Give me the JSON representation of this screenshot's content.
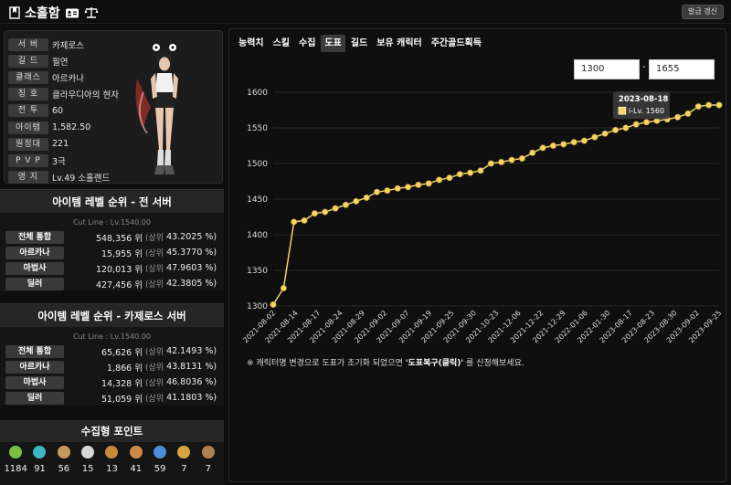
{
  "header": {
    "title": "소홀함",
    "refresh_label": "발급 갱신"
  },
  "profile": {
    "rows": [
      {
        "key": "서 버",
        "value": "카제로스"
      },
      {
        "key": "길 드",
        "value": "필연"
      },
      {
        "key": "클래스",
        "value": "아르카나"
      },
      {
        "key": "칭 호",
        "value": "클라우디아의 현자"
      },
      {
        "key": "전 투",
        "value": "60"
      },
      {
        "key": "아이템",
        "value": "1,582.50"
      },
      {
        "key": "원정대",
        "value": "221"
      },
      {
        "key": "P V P",
        "value": "3극"
      },
      {
        "key": "영 지",
        "value": "Lv.49 소홀랜드"
      }
    ]
  },
  "rank_all": {
    "title": "아이템 레벨 순위 - 전 서버",
    "cutline": "Cut Line : Lv.1540.00",
    "rows": [
      {
        "label": "전체 통합",
        "rank": "548,356 위",
        "sub": "(상위",
        "pct": "43.2025 %)"
      },
      {
        "label": "아르카나",
        "rank": "15,955 위",
        "sub": "(상위",
        "pct": "45.3770 %)"
      },
      {
        "label": "마법사",
        "rank": "120,013 위",
        "sub": "(상위",
        "pct": "47.9603 %)"
      },
      {
        "label": "딜러",
        "rank": "427,456 위",
        "sub": "(상위",
        "pct": "42.3805 %)"
      }
    ]
  },
  "rank_server": {
    "title": "아이템 레벨 순위 - 카제로스 서버",
    "cutline": "Cut Line : Lv.1540.00",
    "rows": [
      {
        "label": "전체 통합",
        "rank": "65,626 위",
        "sub": "(상위",
        "pct": "42.1493 %)"
      },
      {
        "label": "아르카나",
        "rank": "1,866 위",
        "sub": "(상위",
        "pct": "43.8131 %)"
      },
      {
        "label": "마법사",
        "rank": "14,328 위",
        "sub": "(상위",
        "pct": "46.8036 %)"
      },
      {
        "label": "딜러",
        "rank": "51,059 위",
        "sub": "(상위",
        "pct": "41.1803 %)"
      }
    ]
  },
  "collect": {
    "title": "수집형 포인트",
    "items": [
      {
        "icon": "seed-icon",
        "value": "1184",
        "color": "#7bc043"
      },
      {
        "icon": "island-heart-icon",
        "value": "91",
        "color": "#3fb6c8"
      },
      {
        "icon": "art-icon",
        "value": "56",
        "color": "#c49a5a"
      },
      {
        "icon": "giant-heart-icon",
        "value": "15",
        "color": "#d8d8d8"
      },
      {
        "icon": "ignea-token-icon",
        "value": "13",
        "color": "#c98a3a"
      },
      {
        "icon": "masterpiece-icon",
        "value": "41",
        "color": "#cc8844"
      },
      {
        "icon": "leaf-icon",
        "value": "59",
        "color": "#4a8fd9"
      },
      {
        "icon": "orpheus-star-icon",
        "value": "7",
        "color": "#d9a441"
      },
      {
        "icon": "omnium-star-icon",
        "value": "7",
        "color": "#b08050"
      }
    ]
  },
  "tabs": [
    "능력치",
    "스킬",
    "수집",
    "도표",
    "길드",
    "보유 캐릭터",
    "주간골드획득"
  ],
  "active_tab": "도표",
  "range": {
    "from": "1300",
    "sep": "-",
    "to": "1655"
  },
  "note": {
    "prefix": "※ 캐릭터명 변경으로 도표가 초기화 되었으면 ",
    "bold": "'도표복구(클릭)'",
    "suffix": " 를 신청해보세요."
  },
  "colors": {
    "line": "#f0d070",
    "point": "#f5d565",
    "grid": "#2a2a2a"
  },
  "chart_data": {
    "type": "line",
    "ylim": [
      1300,
      1600
    ],
    "yticks": [
      1300,
      1350,
      1400,
      1450,
      1500,
      1550,
      1600
    ],
    "xticks": [
      "2021-08-02",
      "2021-08-14",
      "2021-08-17",
      "2021-08-24",
      "2021-08-29",
      "2021-09-02",
      "2021-09-07",
      "2021-09-19",
      "2021-09-25",
      "2021-09-30",
      "2021-10-23",
      "2021-12-06",
      "2021-12-22",
      "2021-12-29",
      "2022-01-06",
      "2022-01-30",
      "2023-08-17",
      "2023-08-23",
      "2023-08-30",
      "2023-09-02",
      "2023-09-25"
    ],
    "series": [
      {
        "values": [
          1302,
          1325,
          1418,
          1420,
          1430,
          1432,
          1437,
          1442,
          1447,
          1452,
          1460,
          1462,
          1465,
          1467,
          1470,
          1472,
          1477,
          1480,
          1485,
          1487,
          1490,
          1500,
          1502,
          1505,
          1507,
          1515,
          1522,
          1525,
          1527,
          1530,
          1532,
          1537,
          1542,
          1547,
          1550,
          1555,
          1558,
          1560,
          1562,
          1565,
          1570,
          1580,
          1582,
          1582
        ]
      }
    ],
    "tooltip": {
      "date": "2023-08-18",
      "label": "i-Lv.",
      "value": "1560"
    }
  }
}
